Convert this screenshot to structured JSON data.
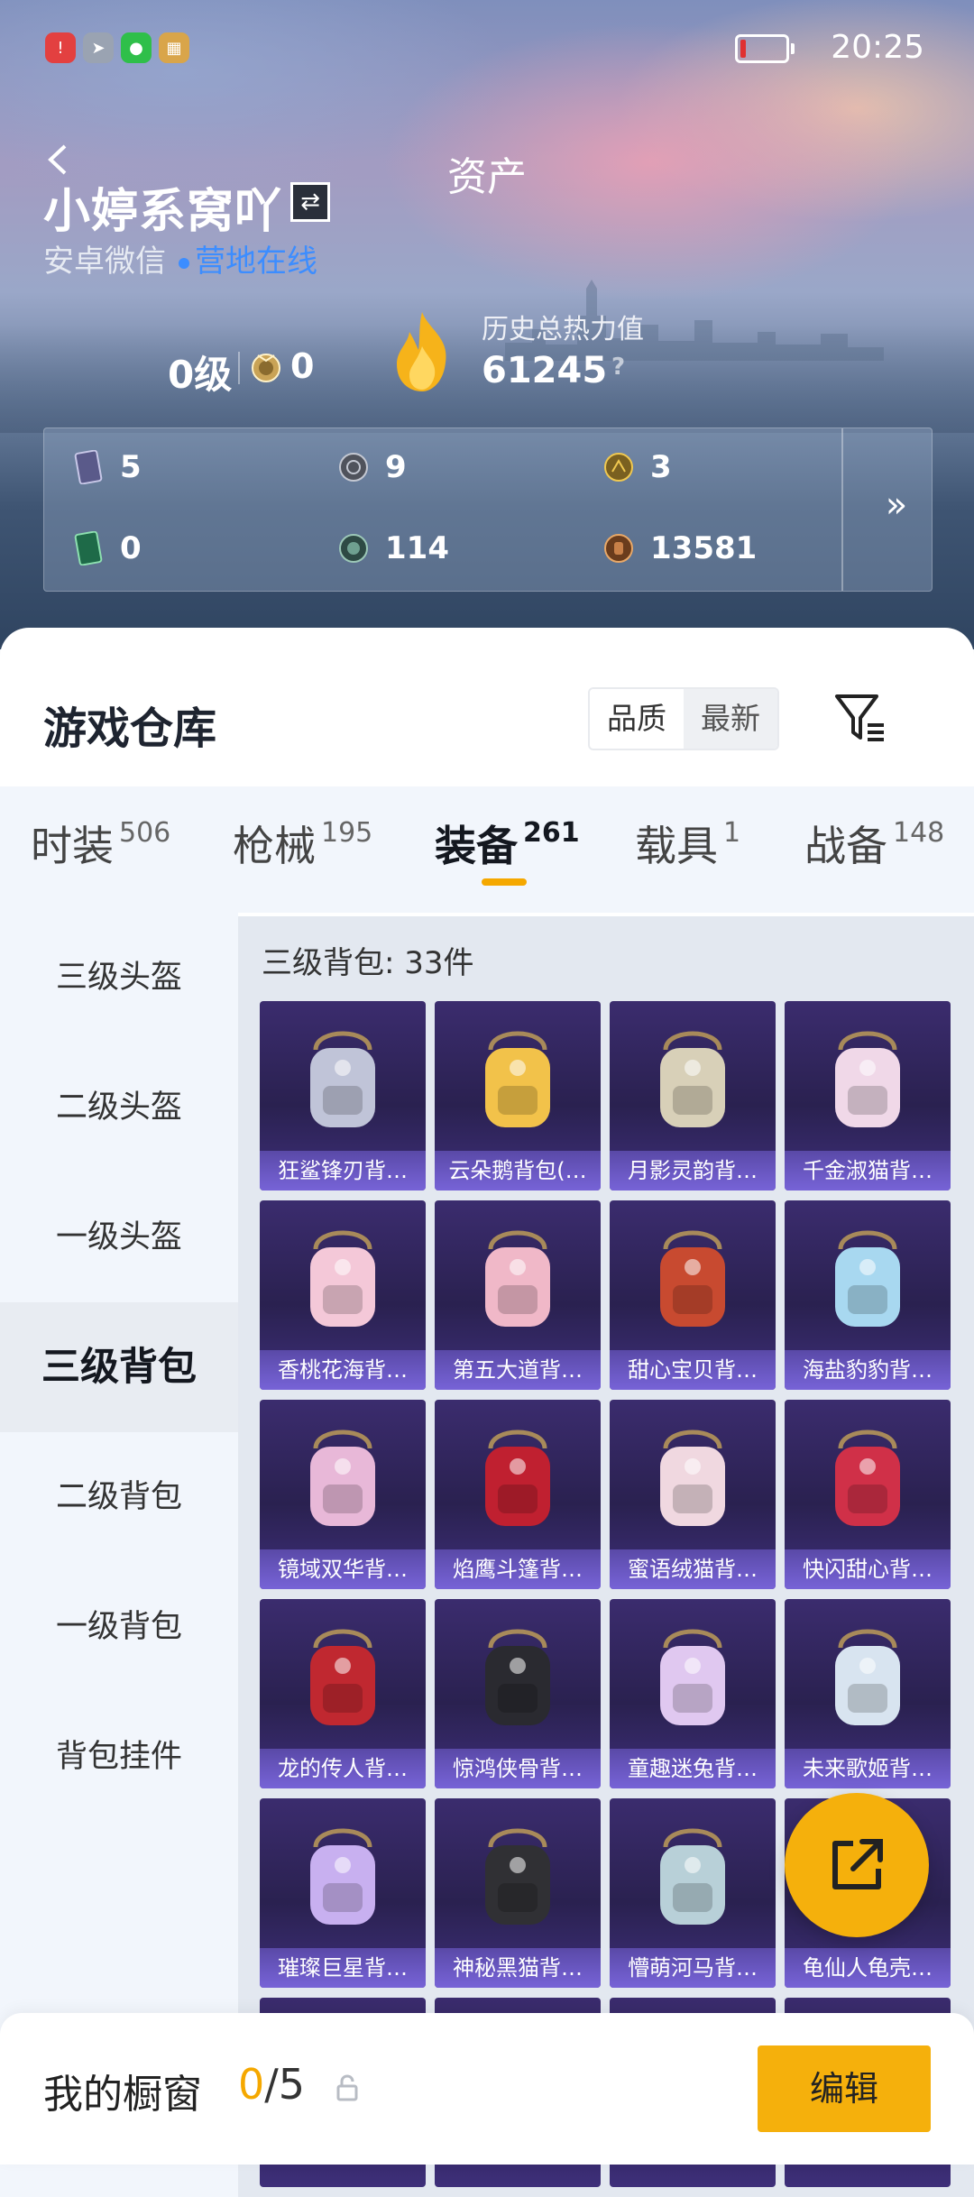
{
  "status_bar": {
    "time": "20:25",
    "notification_icons": [
      "alert-icon",
      "telegram-icon",
      "wechat-icon",
      "game-app-icon"
    ],
    "battery_color": "#e03131"
  },
  "header": {
    "title": "资产",
    "username": "小婷系窝吖",
    "platform": "安卓微信",
    "online_status": "营地在线",
    "level": "0级",
    "medal_count": "0",
    "heat_label": "历史总热力值",
    "heat_value": "61245",
    "help": "?"
  },
  "currencies": [
    {
      "icon": "card-icon",
      "value": "5"
    },
    {
      "icon": "silver-coin-icon",
      "value": "9"
    },
    {
      "icon": "gold-coin-icon",
      "value": "3"
    },
    {
      "icon": "green-card-icon",
      "value": "0"
    },
    {
      "icon": "teal-coin-icon",
      "value": "114"
    },
    {
      "icon": "bronze-coin-icon",
      "value": "13581"
    }
  ],
  "warehouse": {
    "title": "游戏仓库",
    "sort_options": [
      "品质",
      "最新"
    ],
    "sort_selected": "品质",
    "tabs": [
      {
        "label": "时装",
        "count": "506"
      },
      {
        "label": "枪械",
        "count": "195"
      },
      {
        "label": "装备",
        "count": "261"
      },
      {
        "label": "载具",
        "count": "1"
      },
      {
        "label": "战备",
        "count": "148"
      }
    ],
    "active_tab": "装备",
    "categories": [
      "三级头盔",
      "二级头盔",
      "一级头盔",
      "三级背包",
      "二级背包",
      "一级背包",
      "背包挂件"
    ],
    "active_category": "三级背包",
    "section_title": "三级背包: 33件",
    "items": [
      "狂鲨锋刃背…",
      "云朵鹅背包(…",
      "月影灵韵背…",
      "千金淑猫背…",
      "香桃花海背…",
      "第五大道背…",
      "甜心宝贝背…",
      "海盐豹豹背…",
      "镜域双华背…",
      "焰鹰斗篷背…",
      "蜜语绒猫背…",
      "快闪甜心背…",
      "龙的传人背…",
      "惊鸿侠骨背…",
      "童趣迷兔背…",
      "未来歌姬背…",
      "璀璨巨星背…",
      "神秘黑猫背…",
      "懵萌河马背…",
      "龟仙人龟壳…"
    ]
  },
  "showcase": {
    "label": "我的橱窗",
    "current": "0",
    "total": "/5",
    "edit_label": "编辑"
  },
  "colors": {
    "accent": "#f5b00c",
    "online": "#3c8dff",
    "item_bg": "#2a2150"
  }
}
